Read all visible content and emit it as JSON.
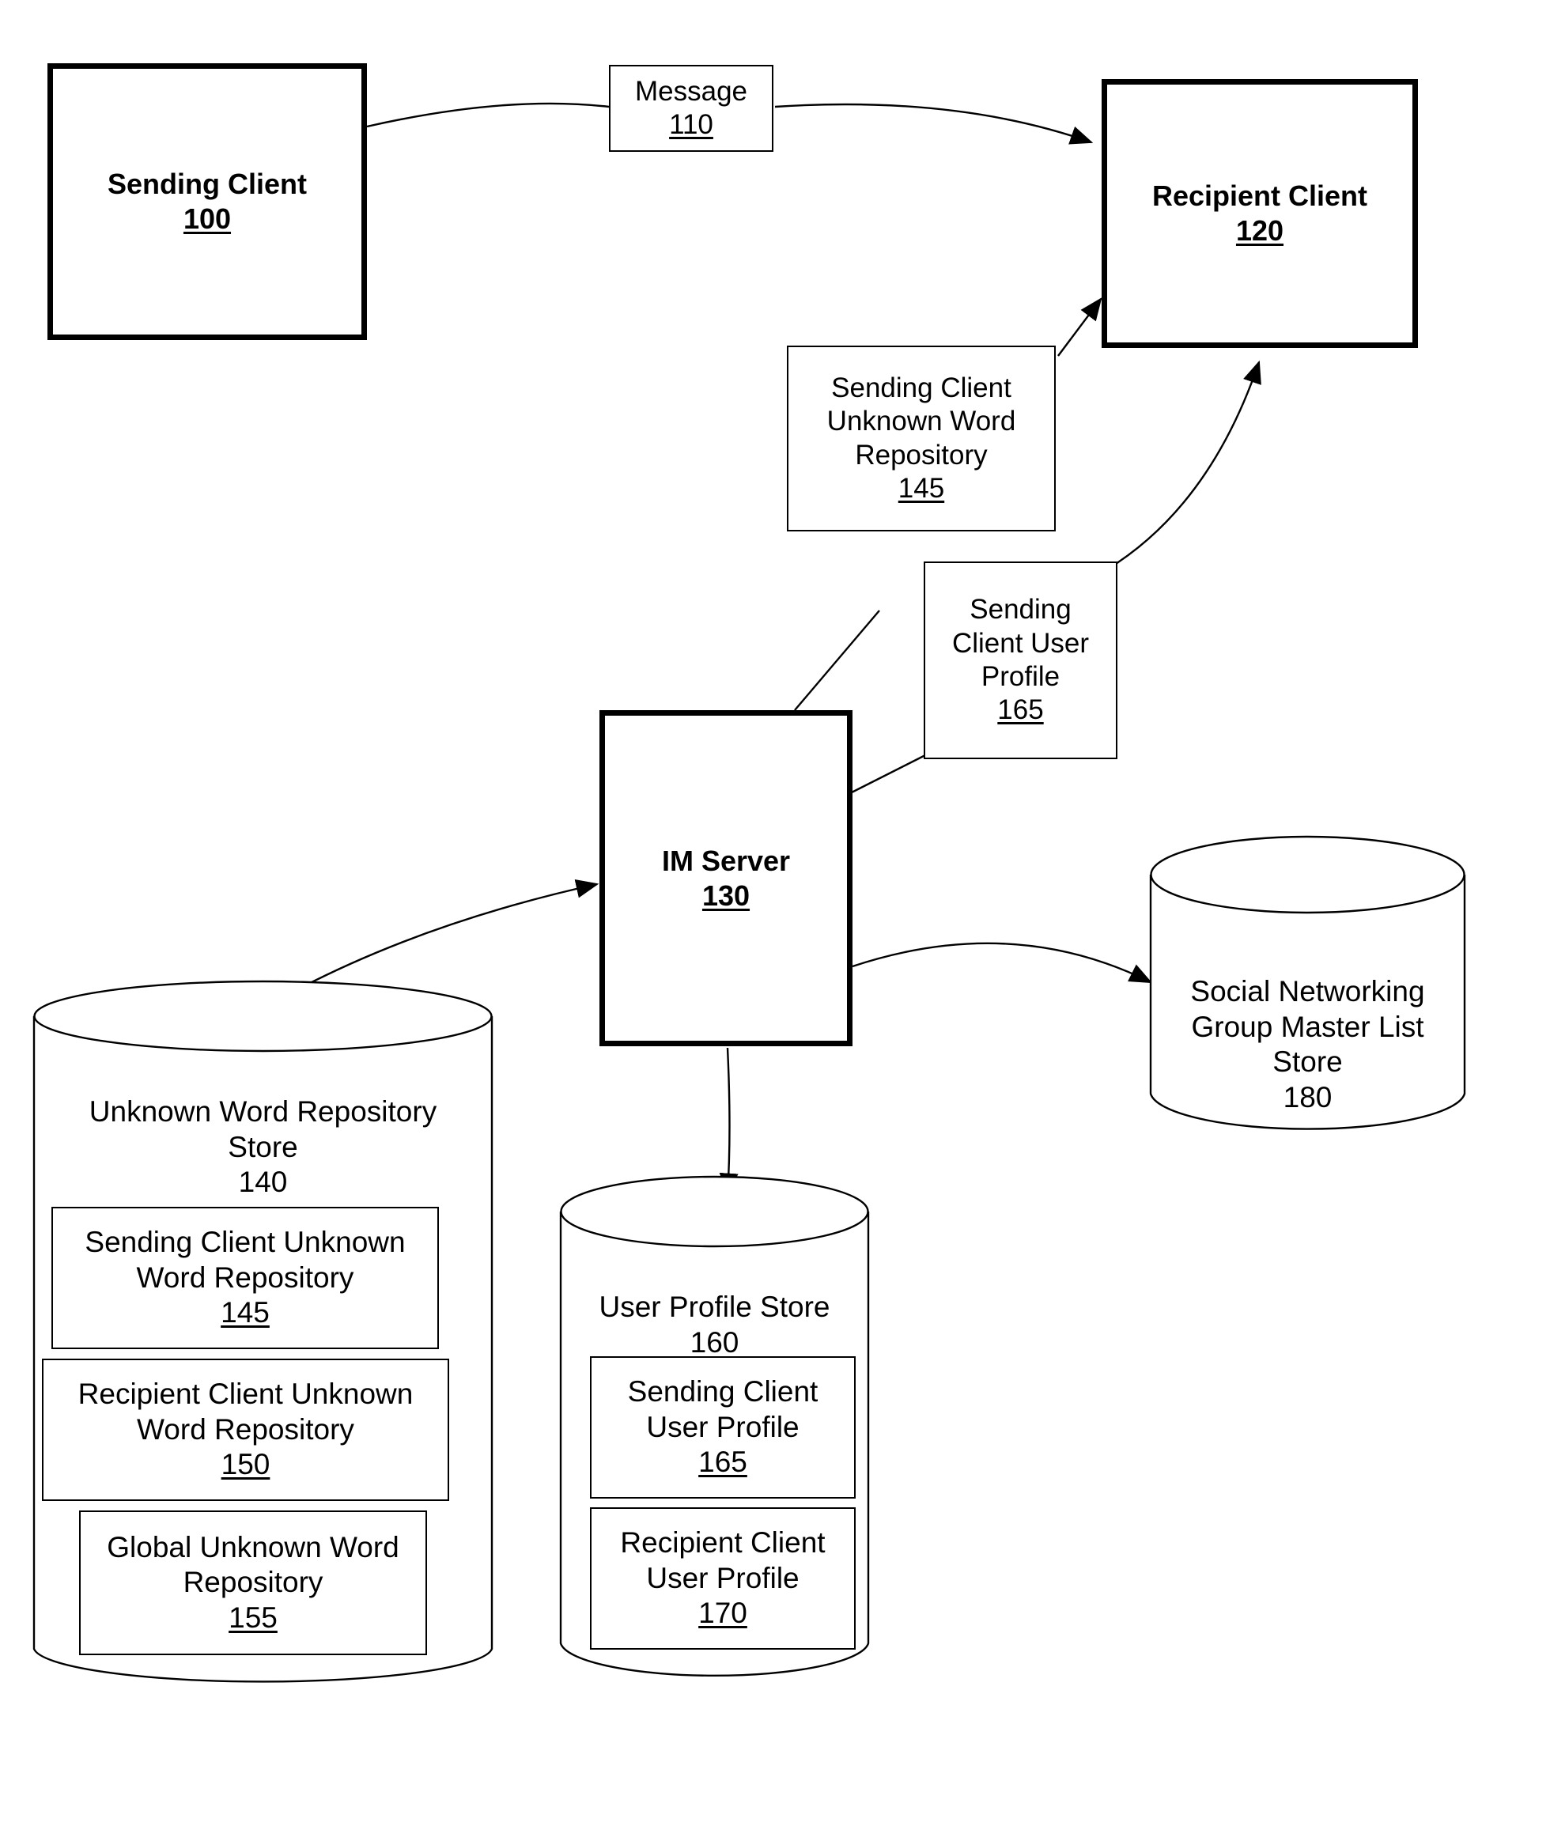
{
  "figure": {
    "type": "patent-block-diagram",
    "background_color": "#ffffff",
    "line_color": "#000000"
  },
  "nodes": {
    "sending_client": {
      "label": "Sending Client",
      "ref": "100"
    },
    "message": {
      "label": "Message",
      "ref": "110"
    },
    "recipient_client": {
      "label": "Recipient Client",
      "ref": "120"
    },
    "sending_client_unknown_word_repository": {
      "label": "Sending Client\nUnknown Word\nRepository",
      "ref": "145"
    },
    "sending_client_user_profile": {
      "label": "Sending\nClient User\nProfile",
      "ref": "165"
    },
    "im_server": {
      "label": "IM Server",
      "ref": "130"
    },
    "unknown_word_repository_store": {
      "label": "Unknown Word Repository\nStore",
      "ref": "140"
    },
    "uwrs_sending_client_unknown_word_repository": {
      "label": "Sending Client Unknown\nWord Repository",
      "ref": "145"
    },
    "uwrs_recipient_client_unknown_word_repository": {
      "label": "Recipient Client Unknown\nWord Repository",
      "ref": "150"
    },
    "uwrs_global_unknown_word_repository": {
      "label": "Global Unknown Word\nRepository",
      "ref": "155"
    },
    "user_profile_store": {
      "label": "User Profile Store",
      "ref": "160"
    },
    "ups_sending_client_user_profile": {
      "label": "Sending Client\nUser Profile",
      "ref": "165"
    },
    "ups_recipient_client_user_profile": {
      "label": "Recipient Client\nUser Profile",
      "ref": "170"
    },
    "social_networking_group_master_list_store": {
      "label": "Social Networking\nGroup Master List\nStore",
      "ref": "180"
    }
  },
  "connections": [
    {
      "name": "sending-client-to-recipient-client",
      "from": "sending_client",
      "to": "recipient_client",
      "via": "message",
      "arrow": "single"
    },
    {
      "name": "scuwr-to-recipient-client",
      "from": "sending_client_unknown_word_repository",
      "to": "recipient_client",
      "arrow": "single"
    },
    {
      "name": "scup-to-recipient-client",
      "from": "sending_client_user_profile",
      "to": "recipient_client",
      "arrow": "single"
    },
    {
      "name": "scuwr-to-im-server",
      "from": "sending_client_unknown_word_repository",
      "to": "im_server",
      "arrow": "none"
    },
    {
      "name": "scup-to-im-server",
      "from": "sending_client_user_profile",
      "to": "im_server",
      "arrow": "none"
    },
    {
      "name": "im-server-to-unknown-word-repository-store",
      "from": "im_server",
      "to": "unknown_word_repository_store",
      "arrow": "double"
    },
    {
      "name": "im-server-to-user-profile-store",
      "from": "im_server",
      "to": "user_profile_store",
      "arrow": "single"
    },
    {
      "name": "im-server-to-social-networking-store",
      "from": "im_server",
      "to": "social_networking_group_master_list_store",
      "arrow": "single"
    }
  ]
}
